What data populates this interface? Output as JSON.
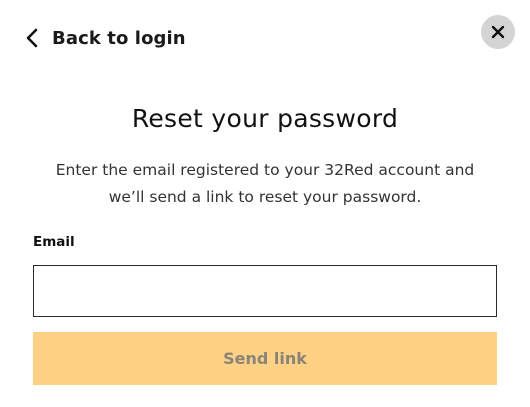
{
  "header": {
    "back_label": "Back to login",
    "back_icon": "chevron-left-icon",
    "close_icon": "close-icon"
  },
  "main": {
    "title": "Reset your password",
    "description_line1": "Enter the email registered to your 32Red account and",
    "description_line2": "we’ll send a link to reset your password."
  },
  "form": {
    "email_label": "Email",
    "email_value": "",
    "email_placeholder": "",
    "submit_label": "Send link",
    "submit_enabled": false
  },
  "colors": {
    "button_disabled_bg": "#fed185",
    "button_disabled_text": "#8a8478",
    "close_bg": "#d4d4d4"
  }
}
